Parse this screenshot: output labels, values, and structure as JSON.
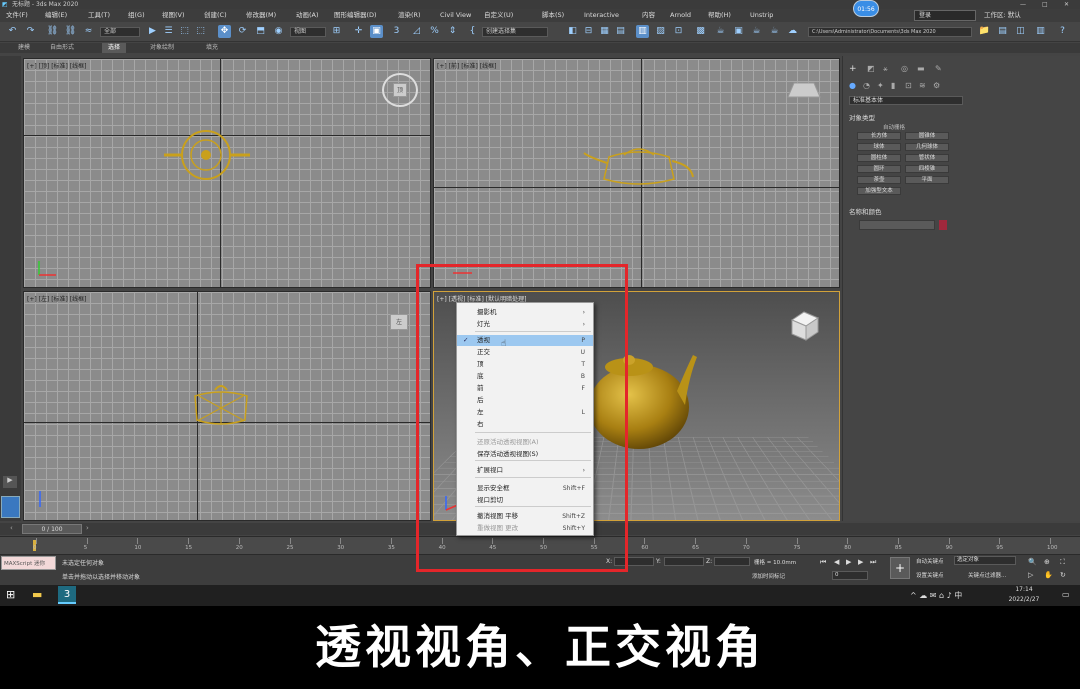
{
  "app": {
    "title": "无标题 - 3ds Max 2020",
    "clock": "01:56"
  },
  "title_buttons": {
    "minimize": "—",
    "maximize": "□",
    "close": "✕"
  },
  "menubar": {
    "items": [
      "文件(F)",
      "编辑(E)",
      "工具(T)",
      "组(G)",
      "视图(V)",
      "创建(C)",
      "修改器(M)",
      "动画(A)",
      "图形编辑器(D)",
      "渲染(R)",
      "Civil View",
      "自定义(U)",
      "脚本(S)",
      "Interactive",
      "内容",
      "Arnold",
      "帮助(H)",
      "Unstrip"
    ],
    "search_placeholder": "登录",
    "workspace": "工作区: 默认"
  },
  "toolbar": {
    "filter_select": "全部",
    "view_select": "视图",
    "selection_set": "创建选择集",
    "path": "C:\\Users\\Administrator\\Documents\\3ds Max 2020"
  },
  "ribbon": {
    "tabs": [
      "建模",
      "自由形式",
      "选择",
      "对象绘制",
      "填充"
    ],
    "active": "选择"
  },
  "viewports": [
    {
      "label": "[+] [顶] [标准] [线框]"
    },
    {
      "label": "[+] [前] [标准] [线框]"
    },
    {
      "label": "[+] [左] [标准] [线框]"
    },
    {
      "label": "[+] [透视] [标准] [默认明暗处理]"
    }
  ],
  "viewcube": {
    "top": "顶",
    "left": "左"
  },
  "command_panel": {
    "category": "标准基本体",
    "object_type_header": "对象类型",
    "autogrid": "自动栅格",
    "buttons": [
      "长方体",
      "圆锥体",
      "球体",
      "几何球体",
      "圆柱体",
      "管状体",
      "圆环",
      "四棱锥",
      "茶壶",
      "平面",
      "加强型文本"
    ],
    "name_color_header": "名称和颜色"
  },
  "context_menu": {
    "items": [
      {
        "label": "摄影机",
        "shortcut": "›",
        "checked": false,
        "disabled": false,
        "highlight": false
      },
      {
        "label": "灯光",
        "shortcut": "›",
        "checked": false,
        "disabled": false,
        "highlight": false
      },
      {
        "label": "透视",
        "shortcut": "P",
        "checked": true,
        "disabled": false,
        "highlight": true
      },
      {
        "label": "正交",
        "shortcut": "U",
        "checked": false,
        "disabled": false,
        "highlight": false
      },
      {
        "label": "顶",
        "shortcut": "T",
        "checked": false,
        "disabled": false,
        "highlight": false
      },
      {
        "label": "底",
        "shortcut": "B",
        "checked": false,
        "disabled": false,
        "highlight": false
      },
      {
        "label": "前",
        "shortcut": "F",
        "checked": false,
        "disabled": false,
        "highlight": false
      },
      {
        "label": "后",
        "shortcut": "",
        "checked": false,
        "disabled": false,
        "highlight": false
      },
      {
        "label": "左",
        "shortcut": "L",
        "checked": false,
        "disabled": false,
        "highlight": false
      },
      {
        "label": "右",
        "shortcut": "",
        "checked": false,
        "disabled": false,
        "highlight": false
      },
      {
        "label": "还原活动透视视图(A)",
        "shortcut": "",
        "checked": false,
        "disabled": true,
        "highlight": false
      },
      {
        "label": "保存活动透视视图(S)",
        "shortcut": "",
        "checked": false,
        "disabled": false,
        "highlight": false
      },
      {
        "label": "扩展视口",
        "shortcut": "›",
        "checked": false,
        "disabled": false,
        "highlight": false
      },
      {
        "label": "显示安全框",
        "shortcut": "Shift+F",
        "checked": false,
        "disabled": false,
        "highlight": false
      },
      {
        "label": "视口剪切",
        "shortcut": "",
        "checked": false,
        "disabled": false,
        "highlight": false
      },
      {
        "label": "撤消视图 平移",
        "shortcut": "Shift+Z",
        "checked": false,
        "disabled": false,
        "highlight": false
      },
      {
        "label": "重做视图 更改",
        "shortcut": "Shift+Y",
        "checked": false,
        "disabled": true,
        "highlight": false
      }
    ]
  },
  "timeline": {
    "frame": "0 / 100",
    "ticks": [
      "0",
      "5",
      "10",
      "15",
      "20",
      "25",
      "30",
      "35",
      "40",
      "45",
      "50",
      "55",
      "60",
      "65",
      "70",
      "75",
      "80",
      "85",
      "90",
      "95",
      "100"
    ]
  },
  "status": {
    "maxscript": "MAXScript 迷你",
    "message1": "未选定任何对象",
    "message2": "单击并拖动以选择并移动对象",
    "x_label": "X:",
    "y_label": "Y:",
    "z_label": "Z:",
    "grid": "栅格 = 10.0mm",
    "add_time_tag": "添加时间标记",
    "auto_key": "自动关键点",
    "selected": "选定对象",
    "set_key": "设置关键点",
    "key_filter": "关键点过滤器...",
    "frame_input": "0"
  },
  "taskbar": {
    "time": "17:14",
    "date": "2022/2/27"
  },
  "caption": {
    "text": "透视视角、正交视角"
  },
  "colors": {
    "accent": "#3a8ee6",
    "highlight": "#e4262a",
    "teapot": "#c9a01c"
  }
}
